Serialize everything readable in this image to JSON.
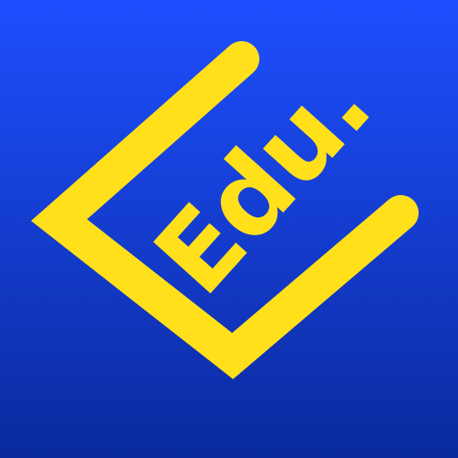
{
  "app_icon": {
    "label": "Edu.",
    "colors": {
      "background_top": "#1e4fff",
      "background_bottom": "#0a2a9e",
      "accent": "#ffe01a"
    },
    "icon": "open-square-bracket-icon"
  }
}
